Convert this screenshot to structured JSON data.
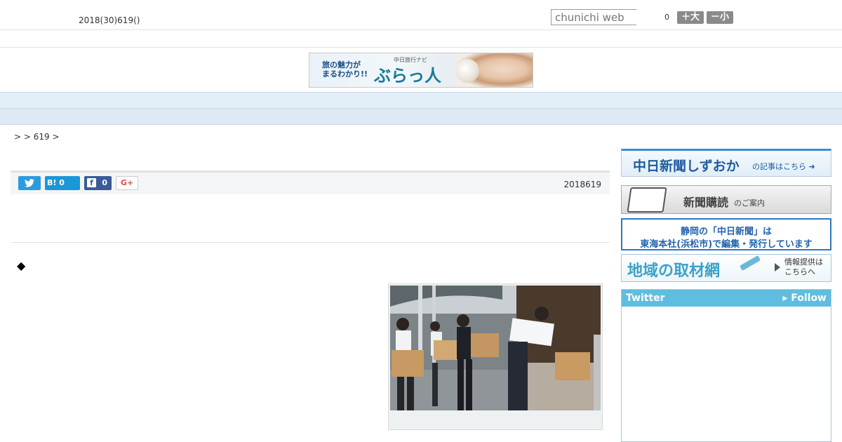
{
  "header": {
    "date": "2018(30)619()",
    "search_placeholder": "chunichi web",
    "count": "0",
    "font_larger_label": "＋大",
    "font_smaller_label": "－小"
  },
  "ad_banner": {
    "tagline": "旅の魅力が\nまるわかり!!",
    "brand_small": "中日旅行ナビ",
    "brand": "ぶらっ人"
  },
  "nav": {
    "items": [
      "",
      "",
      "",
      "",
      "",
      "",
      "",
      "",
      ""
    ]
  },
  "breadcrumb": ">  > 619 >",
  "share": {
    "hatena_label": "B! 0",
    "facebook_count": "0",
    "gplus_label": "G+"
  },
  "article": {
    "date": "2018619",
    "marker": "◆"
  },
  "sidebar": {
    "banner1": {
      "main": "中日新聞しずおか",
      "sub": "の記事はこちら ➜"
    },
    "banner2": {
      "main": "新聞購読",
      "sub": "のご案内"
    },
    "banner3": {
      "line1": "静岡の「中日新聞」は",
      "line2": "東海本社(浜松市)で編集・発行しています"
    },
    "banner4": {
      "main": "地域の取材網",
      "sub1": "情報提供は",
      "sub2": "こちらへ"
    },
    "twitter": {
      "title": "Twitter",
      "follow": "▸ Follow"
    }
  }
}
